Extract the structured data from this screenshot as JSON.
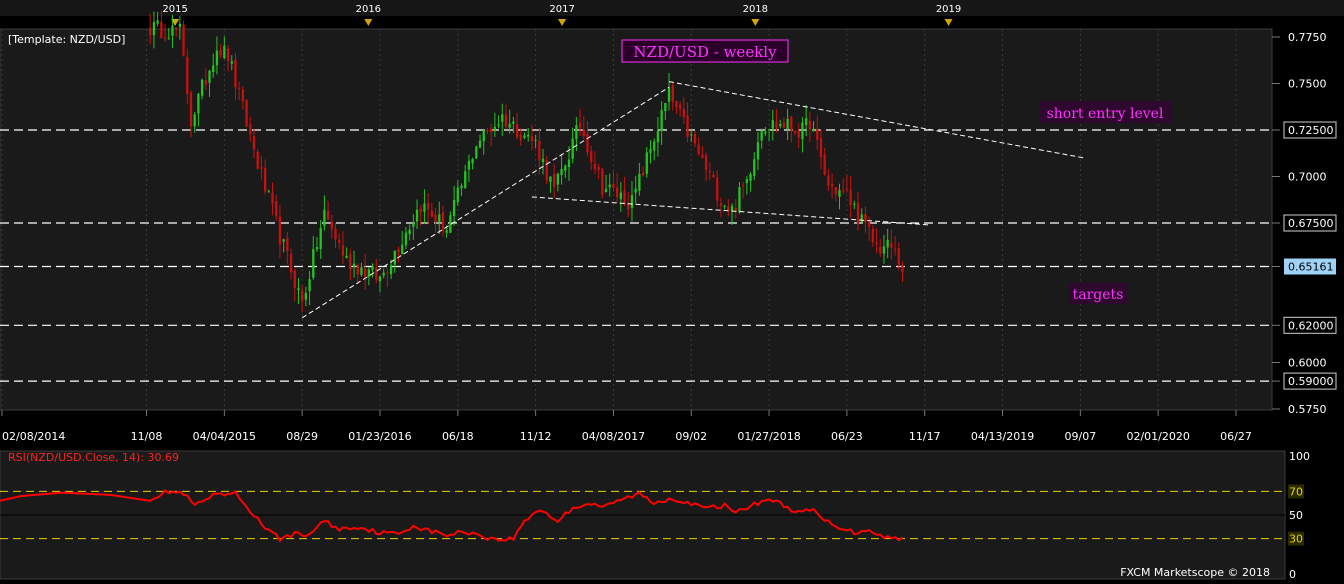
{
  "template_label": "[Template: NZD/USD]",
  "chart_title": "NZD/USD - weekly",
  "annotations": {
    "short_entry": "short entry level",
    "targets": "targets"
  },
  "footer": "FXCM Marketscope © 2018",
  "colors": {
    "background": "#000000",
    "plot_background": "#1a1a1a",
    "up_candle": "#22c422",
    "down_candle": "#c81010",
    "rsi_line": "#ff0000",
    "rsi_levels": "#e8d200",
    "title_text": "#ff33ff",
    "dashed_levels": "#ffffff",
    "current_price_bg": "#9ed3f7"
  },
  "year_markers": [
    "2015",
    "2016",
    "2017",
    "2018",
    "2019"
  ],
  "chart_data": [
    {
      "type": "candlestick",
      "title": "NZD/USD - weekly",
      "x_tick_labels": [
        "02/08/2014",
        "11/08",
        "04/04/2015",
        "08/29",
        "01/23/2016",
        "06/18",
        "11/12",
        "04/08/2017",
        "09/02",
        "01/27/2018",
        "06/23",
        "11/17",
        "04/13/2019",
        "09/07",
        "02/01/2020",
        "06/27"
      ],
      "x_ticks_dates": [
        "2014-02-08",
        "2014-11-08",
        "2015-04-04",
        "2015-08-29",
        "2016-01-23",
        "2016-06-18",
        "2016-11-12",
        "2017-04-08",
        "2017-09-02",
        "2018-01-27",
        "2018-06-23",
        "2018-11-17",
        "2019-04-13",
        "2019-09-07",
        "2020-02-01",
        "2020-06-27"
      ],
      "y_tick_labels": [
        "0.7750",
        "0.7500",
        "0.72500",
        "0.7000",
        "0.67500",
        "0.65161",
        "0.62000",
        "0.6000",
        "0.59000",
        "0.5750"
      ],
      "ylim": [
        0.575,
        0.775
      ],
      "horizontal_levels": [
        0.725,
        0.675,
        0.6516,
        0.62,
        0.59
      ],
      "current_price": 0.65161,
      "trendlines": [
        {
          "from": [
            "2015-08-29",
            0.624
          ],
          "to": [
            "2017-07-22",
            0.748
          ]
        },
        {
          "from": [
            "2017-07-22",
            0.751
          ],
          "to": [
            "2019-09-14",
            0.71
          ]
        },
        {
          "from": [
            "2016-11-05",
            0.689
          ],
          "to": [
            "2018-11-24",
            0.674
          ]
        }
      ],
      "anchors": [
        [
          "2014-11-15",
          0.78
        ],
        [
          "2015-01-10",
          0.778
        ],
        [
          "2015-01-31",
          0.73
        ],
        [
          "2015-03-21",
          0.77
        ],
        [
          "2015-04-11",
          0.765
        ],
        [
          "2015-06-13",
          0.7
        ],
        [
          "2015-07-18",
          0.668
        ],
        [
          "2015-08-29",
          0.632
        ],
        [
          "2015-10-10",
          0.68
        ],
        [
          "2015-11-21",
          0.655
        ],
        [
          "2016-01-23",
          0.645
        ],
        [
          "2016-04-09",
          0.685
        ],
        [
          "2016-05-28",
          0.672
        ],
        [
          "2016-07-23",
          0.718
        ],
        [
          "2016-09-10",
          0.732
        ],
        [
          "2016-11-12",
          0.718
        ],
        [
          "2016-12-17",
          0.692
        ],
        [
          "2017-02-04",
          0.728
        ],
        [
          "2017-03-18",
          0.695
        ],
        [
          "2017-05-13",
          0.686
        ],
        [
          "2017-07-22",
          0.744
        ],
        [
          "2017-08-26",
          0.724
        ],
        [
          "2017-10-28",
          0.688
        ],
        [
          "2017-11-18",
          0.682
        ],
        [
          "2017-12-16",
          0.698
        ],
        [
          "2018-01-13",
          0.728
        ],
        [
          "2018-02-24",
          0.728
        ],
        [
          "2018-03-31",
          0.724
        ],
        [
          "2018-04-14",
          0.73
        ],
        [
          "2018-05-19",
          0.695
        ],
        [
          "2018-06-23",
          0.69
        ],
        [
          "2018-08-18",
          0.662
        ],
        [
          "2018-09-15",
          0.662
        ],
        [
          "2018-10-06",
          0.651
        ]
      ],
      "ohlc_note": "weekly candles reconstructed from anchor closes"
    },
    {
      "type": "line",
      "title": "RSI(NZD/USD.Close, 14): 30.69",
      "series": [
        {
          "name": "RSI(NZD/USD.Close, 14)"
        }
      ],
      "ylim": [
        0,
        100
      ],
      "y_tick_labels": [
        "100",
        "70",
        "50",
        "30",
        "0"
      ],
      "levels": [
        70,
        50,
        30
      ],
      "last_value": 30.69,
      "anchors": [
        [
          "2014-11-15",
          64
        ],
        [
          "2014-12-20",
          70
        ],
        [
          "2015-01-17",
          68
        ],
        [
          "2015-02-07",
          58
        ],
        [
          "2015-03-14",
          66
        ],
        [
          "2015-04-25",
          68
        ],
        [
          "2015-05-30",
          50
        ],
        [
          "2015-06-27",
          36
        ],
        [
          "2015-07-18",
          30
        ],
        [
          "2015-08-15",
          34
        ],
        [
          "2015-09-05",
          32
        ],
        [
          "2015-10-10",
          45
        ],
        [
          "2015-11-07",
          38
        ],
        [
          "2015-12-12",
          40
        ],
        [
          "2016-01-23",
          35
        ],
        [
          "2016-02-27",
          34
        ],
        [
          "2016-03-26",
          41
        ],
        [
          "2016-04-30",
          36
        ],
        [
          "2016-05-28",
          33
        ],
        [
          "2016-07-02",
          36
        ],
        [
          "2016-07-30",
          33
        ],
        [
          "2016-08-27",
          29
        ],
        [
          "2016-10-01",
          30
        ],
        [
          "2016-10-22",
          45
        ],
        [
          "2016-11-19",
          55
        ],
        [
          "2016-12-24",
          45
        ],
        [
          "2017-01-21",
          56
        ],
        [
          "2017-02-18",
          60
        ],
        [
          "2017-03-25",
          57
        ],
        [
          "2017-04-22",
          63
        ],
        [
          "2017-05-27",
          68
        ],
        [
          "2017-06-24",
          60
        ],
        [
          "2017-07-22",
          64
        ],
        [
          "2017-08-19",
          62
        ],
        [
          "2017-09-16",
          57
        ],
        [
          "2017-10-07",
          56
        ],
        [
          "2017-11-04",
          58
        ],
        [
          "2017-12-02",
          53
        ],
        [
          "2017-12-30",
          59
        ],
        [
          "2018-01-27",
          64
        ],
        [
          "2018-02-24",
          58
        ],
        [
          "2018-03-24",
          52
        ],
        [
          "2018-04-21",
          54
        ],
        [
          "2018-05-12",
          45
        ],
        [
          "2018-06-09",
          40
        ],
        [
          "2018-07-07",
          35
        ],
        [
          "2018-08-04",
          38
        ],
        [
          "2018-09-01",
          31
        ],
        [
          "2018-10-06",
          30.69
        ]
      ]
    }
  ]
}
